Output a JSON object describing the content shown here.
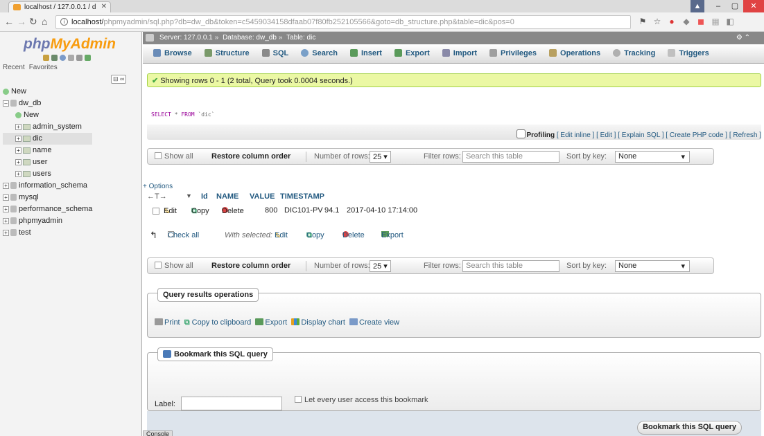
{
  "browser": {
    "tab_title": "localhost / 127.0.0.1 / d",
    "url_host": "localhost/",
    "url_path": "phpmyadmin/sql.php?db=dw_db&token=c5459034158dfaab07f80fb252105566&goto=db_structure.php&table=dic&pos=0"
  },
  "sidebar": {
    "logo_php": "php",
    "logo_myadmin": "MyAdmin",
    "recent": "Recent",
    "favorites": "Favorites",
    "tree": [
      {
        "label": "New"
      },
      {
        "label": "dw_db"
      },
      {
        "label": "New"
      },
      {
        "label": "admin_system"
      },
      {
        "label": "dic"
      },
      {
        "label": "name"
      },
      {
        "label": "user"
      },
      {
        "label": "users"
      },
      {
        "label": "information_schema"
      },
      {
        "label": "mysql"
      },
      {
        "label": "performance_schema"
      },
      {
        "label": "phpmyadmin"
      },
      {
        "label": "test"
      }
    ]
  },
  "breadcrumb": {
    "server": "Server: 127.0.0.1",
    "database": "Database: dw_db",
    "table": "Table: dic"
  },
  "tabs": [
    {
      "label": "Browse",
      "color": "#6a8cb8"
    },
    {
      "label": "Structure",
      "color": "#7a9a6a"
    },
    {
      "label": "SQL",
      "color": "#8a8a8a"
    },
    {
      "label": "Search",
      "color": "#7aa0c8"
    },
    {
      "label": "Insert",
      "color": "#5a9a5a"
    },
    {
      "label": "Export",
      "color": "#5a9a5a"
    },
    {
      "label": "Import",
      "color": "#8a8aa8"
    },
    {
      "label": "Privileges",
      "color": "#a0a0a0"
    },
    {
      "label": "Operations",
      "color": "#b8a060"
    },
    {
      "label": "Tracking",
      "color": "#b0b0b0"
    },
    {
      "label": "Triggers",
      "color": "#c0c0c0"
    }
  ],
  "message": {
    "success": "Showing rows 0 - 1 (2 total, Query took 0.0004 seconds.)"
  },
  "sql": {
    "kw_select": "SELECT",
    "star": " * ",
    "kw_from": "FROM",
    "table": " `dic`"
  },
  "profiling": {
    "label": "Profiling",
    "links": "[ Edit inline ] [ Edit ] [ Explain SQL ] [ Create PHP code ] [ Refresh ]"
  },
  "navbar": {
    "show_all": "Show all",
    "restore": "Restore column order",
    "num_rows_label": "Number of rows:",
    "num_rows_value": "25",
    "filter_label": "Filter rows:",
    "filter_placeholder": "Search this table",
    "sort_label": "Sort by key:",
    "sort_value": "None"
  },
  "results": {
    "options": "+ Options",
    "headers": [
      "Id",
      "NAME",
      "VALUE",
      "TIMESTAMP"
    ],
    "row": {
      "edit": "Edit",
      "copy": "Copy",
      "delete": "Delete",
      "id": "800",
      "name": "DIC101-PV",
      "value": "94.1",
      "timestamp": "2017-04-10 17:14:00"
    },
    "check_all": "Check all",
    "with_selected": "With selected:",
    "bulk_edit": "Edit",
    "bulk_copy": "Copy",
    "bulk_delete": "Delete",
    "bulk_export": "Export"
  },
  "qro": {
    "legend": "Query results operations",
    "print": "Print",
    "copy_clipboard": "Copy to clipboard",
    "export": "Export",
    "display_chart": "Display chart",
    "create_view": "Create view"
  },
  "bookmark": {
    "legend": "Bookmark this SQL query",
    "label": "Label:",
    "share": "Let every user access this bookmark",
    "button": "Bookmark this SQL query"
  },
  "console": "Console"
}
